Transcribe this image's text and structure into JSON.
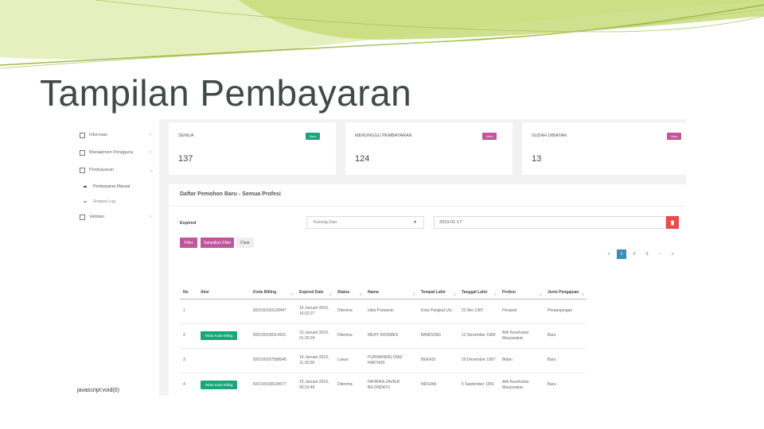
{
  "slide": {
    "title": "Tampilan Pembayaran"
  },
  "colors": {
    "accent_green": "#1aa67a",
    "accent_pink": "#c0569b",
    "pager_blue": "#3c8dbc",
    "danger_red": "#e94b4b",
    "deco_green": "#c7dc7a"
  },
  "sidebar": {
    "items": [
      {
        "label": "Informasi",
        "icon": "copy-icon",
        "chevron": "›"
      },
      {
        "label": "Manajemen Pengguna",
        "icon": "copy-icon",
        "chevron": "›"
      },
      {
        "label": "Pembayaran",
        "icon": "copy-icon",
        "chevron": "⌄"
      },
      {
        "label": "Validasi",
        "icon": "copy-icon",
        "chevron": "›"
      }
    ],
    "subitems": [
      {
        "label": "Pembayaran Manual"
      },
      {
        "label": "Simponi Log"
      }
    ]
  },
  "status_bar": "javascript:void(0)",
  "cards": [
    {
      "label": "SEMUA",
      "count": "137",
      "button": "View"
    },
    {
      "label": "MENUNGGU PEMBAYARAN",
      "count": "124",
      "button": "View"
    },
    {
      "label": "SUDAH DIBAYAR",
      "count": "13",
      "button": "View"
    }
  ],
  "panel": {
    "title": "Daftar Pemohon Baru - Semua Profesi",
    "filter_label": "Expired",
    "select_value": "Kurang Dari",
    "date_value": "2019-01-17",
    "delete_icon": "trash-icon",
    "buttons": {
      "filter": "Filter",
      "show_filter": "Tampilkan Filter",
      "clear": "Clear"
    },
    "pagination": [
      "«",
      "1",
      "2",
      "3",
      "›",
      "»"
    ]
  },
  "table": {
    "headers": [
      "No",
      "Aksi",
      "Kode Billing",
      "Expired Date",
      "Status",
      "Nama",
      "Tempat Lahir",
      "Tanggal Lahir",
      "Profesi",
      "Jenis Pengajuan"
    ],
    "rows": [
      {
        "no": "1",
        "aksi": "",
        "kode": "820190109128447",
        "expired": "16 Januari 2019, 16:02:27",
        "status": "Diterima",
        "nama": "Iskia Purwanto",
        "tempat": "Kota Pangkal Ulu",
        "tanggal": "23 Mei 1987",
        "profesi": "Perawat",
        "jenis": "Perpanjangan"
      },
      {
        "no": "2",
        "aksi": "Minta Kode Billing",
        "kode": "820190108114431",
        "expired": "15 Januari 2019, 01:20:24",
        "status": "Diterima",
        "nama": "MERY KRISMES",
        "tempat": "BANDUNG",
        "tanggal": "12 November 1984",
        "profesi": "Ahli Kesehatan Masyarakat",
        "jenis": "Baru"
      },
      {
        "no": "3",
        "aksi": "",
        "kode": "820190107588648",
        "expired": "14 Januari 2019, 11:26:58",
        "status": "Lunas",
        "nama": "PURWANING DIAZ HAKYADI",
        "tempat": "BEKASI",
        "tanggal": "29 Desember 1987",
        "profesi": "Bidan",
        "jenis": "Baru"
      },
      {
        "no": "4",
        "aksi": "Minta Kode Billing",
        "kode": "820190108104577",
        "expired": "15 Januari 2019, 00:23:49",
        "status": "Diterima",
        "nama": "FAHRIKA ZAVIER BILONDATU",
        "tempat": "INDUAN",
        "tanggal": "5 September 1991",
        "profesi": "Ahli Kesehatan Masyarakat",
        "jenis": "Baru"
      }
    ]
  }
}
